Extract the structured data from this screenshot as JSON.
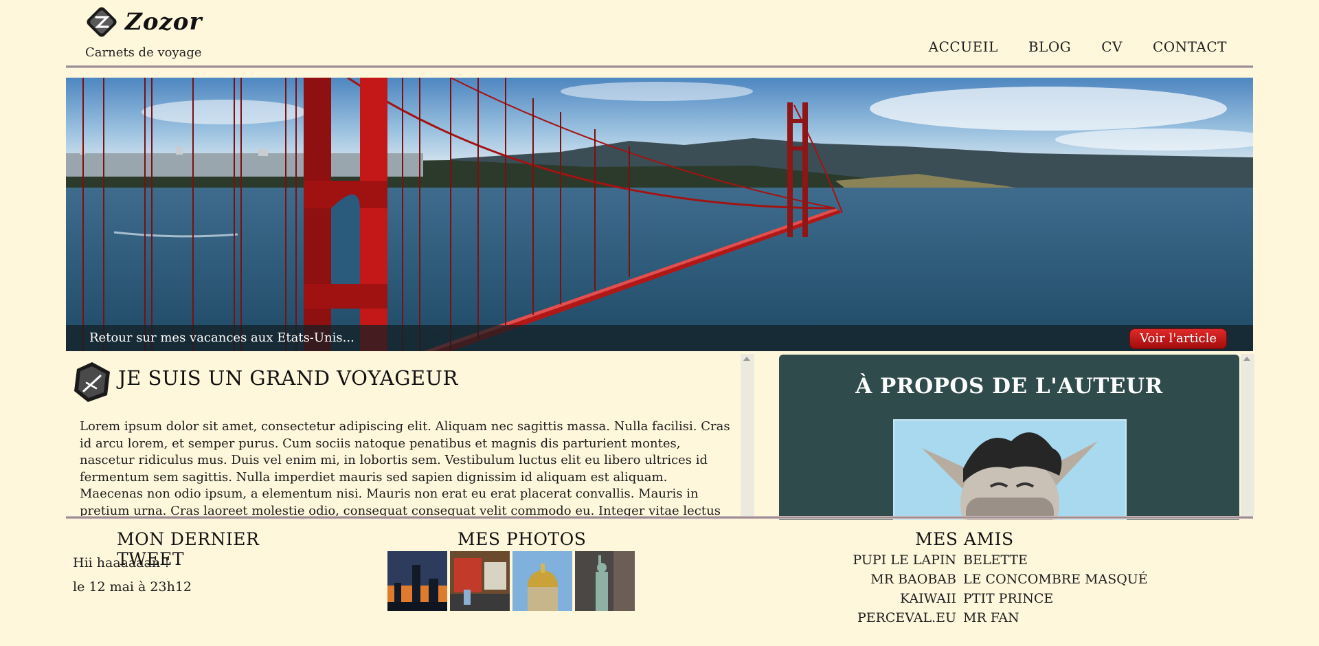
{
  "header": {
    "brand": "Zozor",
    "tagline": "Carnets de voyage",
    "nav": [
      {
        "label": "ACCUEIL"
      },
      {
        "label": "BLOG"
      },
      {
        "label": "CV"
      },
      {
        "label": "CONTACT"
      }
    ]
  },
  "banner": {
    "caption": "Retour sur mes vacances aux Etats-Unis...",
    "button": "Voir l'article",
    "accent_color": "#c81414"
  },
  "article": {
    "title": "JE SUIS UN GRAND VOYAGEUR",
    "body": "Lorem ipsum dolor sit amet, consectetur adipiscing elit. Aliquam nec sagittis massa. Nulla facilisi. Cras id arcu lorem, et semper purus. Cum sociis natoque penatibus et magnis dis parturient montes, nascetur ridiculus mus. Duis vel enim mi, in lobortis sem. Vestibulum luctus elit eu libero ultrices id fermentum sem sagittis. Nulla imperdiet mauris sed sapien dignissim id aliquam est aliquam. Maecenas non odio ipsum, a elementum nisi. Mauris non erat eu erat placerat convallis. Mauris in pretium urna. Cras laoreet molestie odio, consequat consequat velit commodo eu. Integer vitae lectus ac nunc posuere pellentesque non at eros. Suspendisse non"
  },
  "about": {
    "title": "À PROPOS DE L'AUTEUR",
    "panel_color": "#2f4b4c"
  },
  "footer": {
    "tweet": {
      "title": "MON DERNIER TWEET",
      "text": "Hii haaaaaan !",
      "date": "le 12 mai à 23h12"
    },
    "photos": {
      "title": "MES PHOTOS"
    },
    "friends": {
      "title": "MES AMIS",
      "left": [
        "PUPI LE LAPIN",
        "MR BAOBAB",
        "KAIWAII",
        "PERCEVAL.EU"
      ],
      "right": [
        "BELETTE",
        "LE CONCOMBRE MASQUÉ",
        "PTIT PRINCE",
        "MR FAN"
      ]
    }
  }
}
